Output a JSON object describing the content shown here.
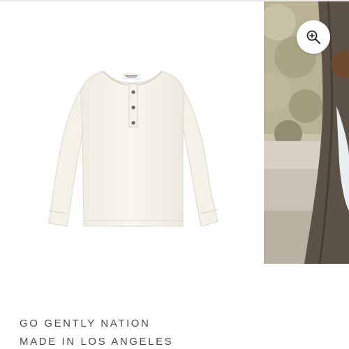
{
  "gallery": {
    "zoom_icon": "zoom-in-icon",
    "slides": [
      {
        "kind": "product-image",
        "subject": "henley-shirt"
      },
      {
        "kind": "lifestyle-photo"
      }
    ]
  },
  "brand": {
    "line1": "GO GENTLY NATION",
    "line2": "MADE IN LOS ANGELES"
  },
  "colors": {
    "shirt": "#f6f4ec",
    "text": "#4a4a4a",
    "button_bg": "#ffffff"
  }
}
